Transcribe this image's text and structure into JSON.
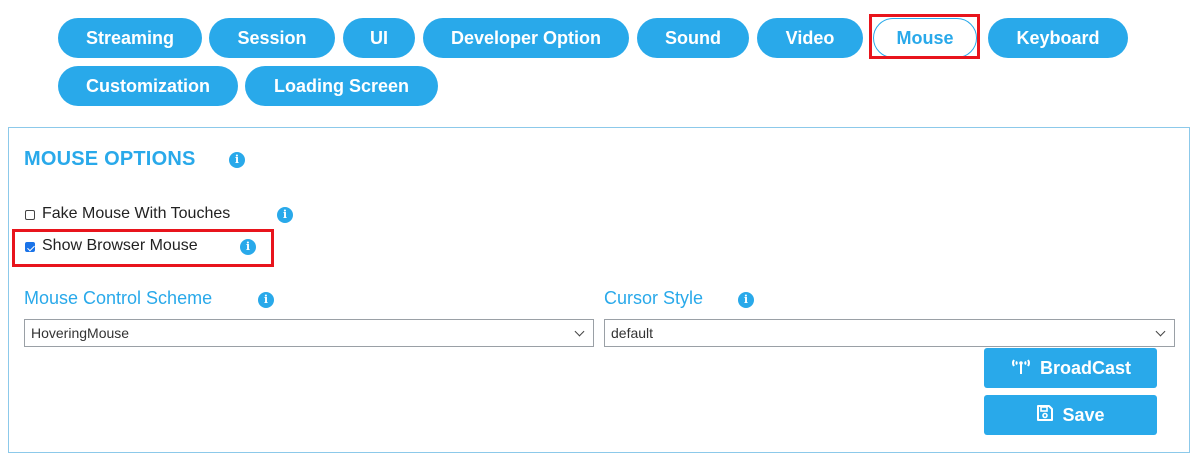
{
  "tabs": [
    {
      "label": "Streaming"
    },
    {
      "label": "Session"
    },
    {
      "label": "UI"
    },
    {
      "label": "Developer Option"
    },
    {
      "label": "Sound"
    },
    {
      "label": "Video"
    },
    {
      "label": "Mouse",
      "active": true
    },
    {
      "label": "Keyboard"
    },
    {
      "label": "Customization"
    },
    {
      "label": "Loading Screen"
    }
  ],
  "panel": {
    "title": "MOUSE OPTIONS",
    "options": [
      {
        "label": "Fake Mouse With Touches",
        "checked": false
      },
      {
        "label": "Show Browser Mouse",
        "checked": true
      }
    ],
    "fields": [
      {
        "label": "Mouse Control Scheme",
        "value": "HoveringMouse"
      },
      {
        "label": "Cursor Style",
        "value": "default"
      }
    ],
    "buttons": {
      "broadcast": "BroadCast",
      "save": "Save"
    }
  },
  "icons": {
    "info": "info-icon",
    "broadcast": "antenna-icon",
    "save": "floppy-disk-icon",
    "dropdown": "chevron-down-icon"
  },
  "colors": {
    "accent": "#29a9ea",
    "highlight": "#e8141c",
    "panel_border": "#8cc9ea"
  }
}
